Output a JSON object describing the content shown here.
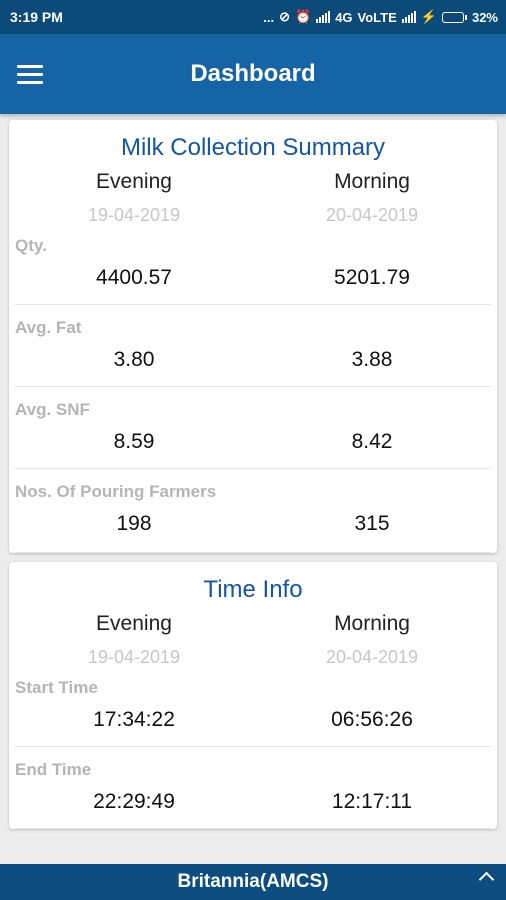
{
  "status_bar": {
    "time": "3:19 PM",
    "dots": "...",
    "network": "4G",
    "volte": "VoLTE",
    "battery": "32%",
    "battery_level": 0.32
  },
  "app_bar": {
    "title": "Dashboard",
    "menu_icon": "hamburger-menu-icon"
  },
  "milk_summary": {
    "title": "Milk Collection Summary",
    "shifts": [
      {
        "name": "Evening",
        "date": "19-04-2019"
      },
      {
        "name": "Morning",
        "date": "20-04-2019"
      }
    ],
    "rows": [
      {
        "label": "Qty.",
        "evening": "4400.57",
        "morning": "5201.79"
      },
      {
        "label": "Avg. Fat",
        "evening": "3.80",
        "morning": "3.88"
      },
      {
        "label": "Avg. SNF",
        "evening": "8.59",
        "morning": "8.42"
      },
      {
        "label": "Nos. Of Pouring Farmers",
        "evening": "198",
        "morning": "315"
      }
    ]
  },
  "time_info": {
    "title": "Time Info",
    "shifts": [
      {
        "name": "Evening",
        "date": "19-04-2019"
      },
      {
        "name": "Morning",
        "date": "20-04-2019"
      }
    ],
    "rows": [
      {
        "label": "Start Time",
        "evening": "17:34:22",
        "morning": "06:56:26"
      },
      {
        "label": "End Time",
        "evening": "22:29:49",
        "morning": "12:17:11"
      }
    ]
  },
  "bottom_bar": {
    "label": "Britannia(AMCS)",
    "icon": "chevron-up-icon"
  },
  "colors": {
    "status_bar": "#0b4a79",
    "app_bar": "#1564a6",
    "title_blue": "#1357a6",
    "bottom_bar": "#0d4d80"
  }
}
